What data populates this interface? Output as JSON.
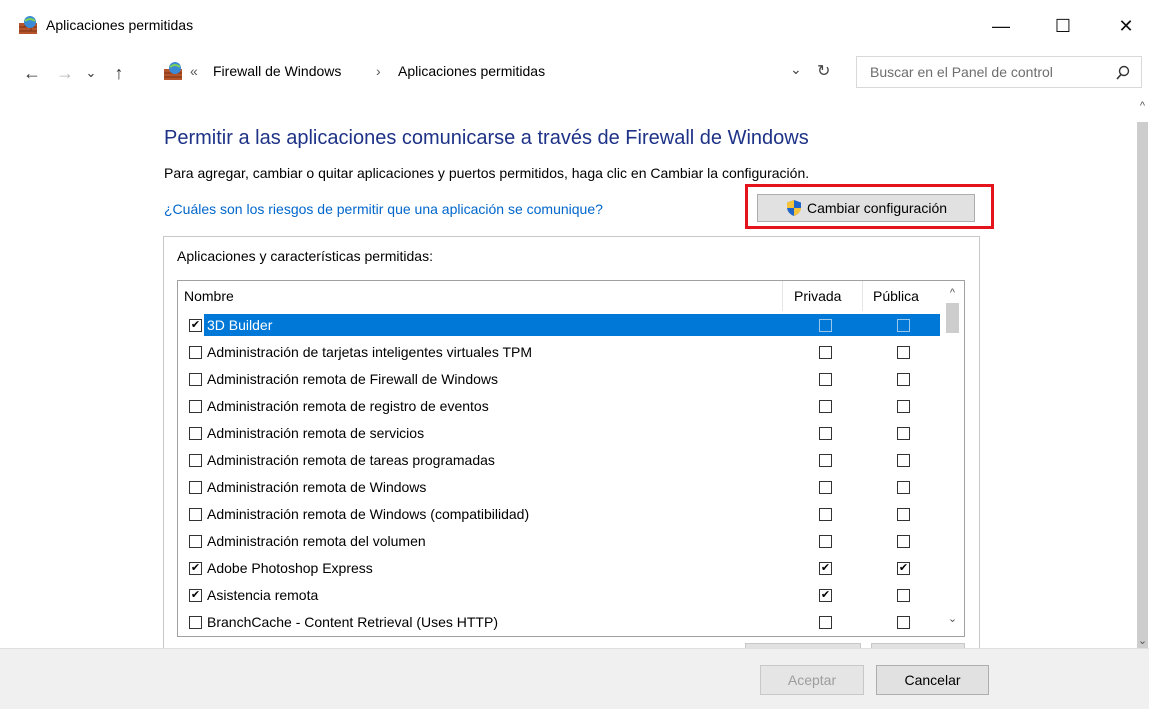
{
  "window": {
    "title": "Aplicaciones permitidas",
    "minimize": "—",
    "maximize": "☐",
    "close": "✕"
  },
  "nav": {
    "back": "←",
    "forward": "→",
    "recent": "⌄",
    "up": "↑",
    "overflow": "«",
    "breadcrumb": [
      "Firewall de Windows",
      "Aplicaciones permitidas"
    ],
    "separator": "›",
    "dropdown": "⌄",
    "refresh": "↻",
    "search_placeholder": "Buscar en el Panel de control",
    "search_icon": "⚲"
  },
  "content": {
    "heading": "Permitir a las aplicaciones comunicarse a través de Firewall de Windows",
    "description": "Para agregar, cambiar o quitar aplicaciones y puertos permitidos, haga clic en Cambiar la configuración.",
    "risk_link": "¿Cuáles son los riesgos de permitir que una aplicación se comunique?",
    "change_button": "Cambiar configuración",
    "panel_label": "Aplicaciones y características permitidas:"
  },
  "table": {
    "columns": {
      "name": "Nombre",
      "private": "Privada",
      "public": "Pública"
    },
    "rows": [
      {
        "name": "3D Builder",
        "enabled": true,
        "private": false,
        "public": false
      },
      {
        "name": "Administración de tarjetas inteligentes virtuales TPM",
        "enabled": false,
        "private": false,
        "public": false
      },
      {
        "name": "Administración remota de Firewall de Windows",
        "enabled": false,
        "private": false,
        "public": false
      },
      {
        "name": "Administración remota de registro de eventos",
        "enabled": false,
        "private": false,
        "public": false
      },
      {
        "name": "Administración remota de servicios",
        "enabled": false,
        "private": false,
        "public": false
      },
      {
        "name": "Administración remota de tareas programadas",
        "enabled": false,
        "private": false,
        "public": false
      },
      {
        "name": "Administración remota de Windows",
        "enabled": false,
        "private": false,
        "public": false
      },
      {
        "name": "Administración remota de Windows (compatibilidad)",
        "enabled": false,
        "private": false,
        "public": false
      },
      {
        "name": "Administración remota del volumen",
        "enabled": false,
        "private": false,
        "public": false
      },
      {
        "name": "Adobe Photoshop Express",
        "enabled": true,
        "private": true,
        "public": true
      },
      {
        "name": "Asistencia remota",
        "enabled": true,
        "private": true,
        "public": false
      },
      {
        "name": "BranchCache - Content Retrieval (Uses HTTP)",
        "enabled": false,
        "private": false,
        "public": false
      }
    ],
    "selected_index": 0
  },
  "footer": {
    "accept": "Aceptar",
    "cancel": "Cancelar"
  },
  "colors": {
    "heading": "#1e3287",
    "link": "#0066cc",
    "selection": "#0078d7",
    "highlight_box": "#e5141c"
  }
}
